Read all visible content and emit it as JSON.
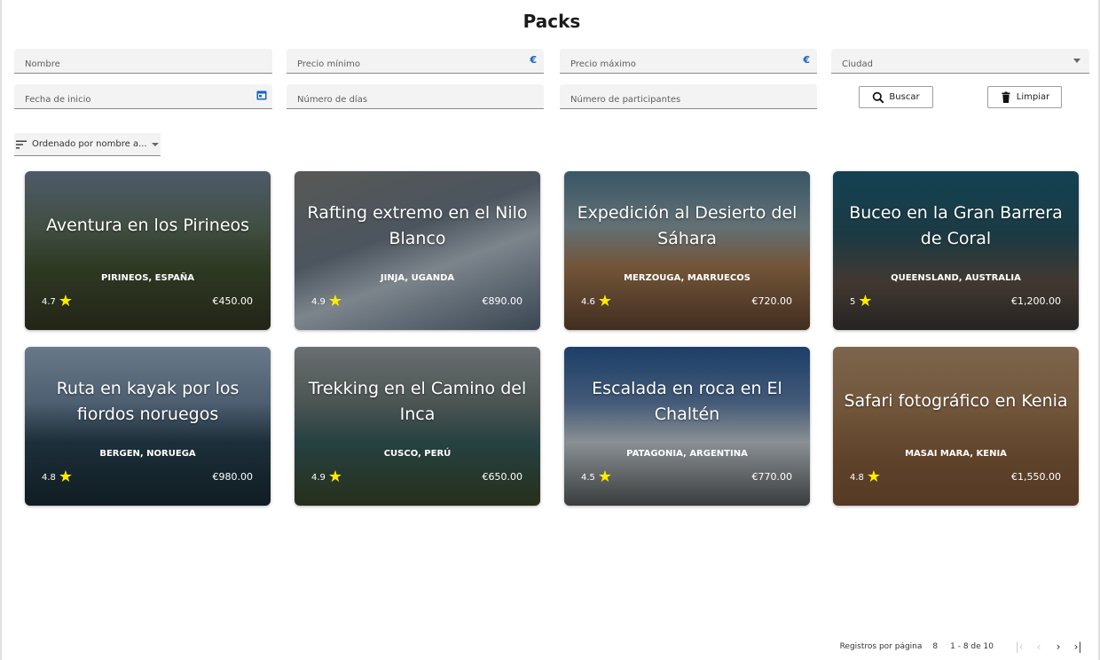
{
  "page": {
    "title": "Packs"
  },
  "filters": {
    "nombre": {
      "placeholder": "Nombre"
    },
    "precio_minimo": {
      "placeholder": "Precio mínimo",
      "suffix": "€"
    },
    "precio_maximo": {
      "placeholder": "Precio máximo",
      "suffix": "€"
    },
    "ciudad": {
      "placeholder": "Ciudad"
    },
    "fecha_inicio": {
      "placeholder": "Fecha de inicio"
    },
    "numero_dias": {
      "placeholder": "Número de días"
    },
    "numero_participantes": {
      "placeholder": "Número de participantes"
    },
    "buscar_label": "Buscar",
    "limpiar_label": "Limpiar"
  },
  "sort": {
    "label": "Ordenado por nombre a..."
  },
  "cards": [
    {
      "title": "Aventura en los Pirineos",
      "location": "PIRINEOS, ESPAÑA",
      "rating": "4.7",
      "price": "€450.00"
    },
    {
      "title": "Rafting extremo en el Nilo Blanco",
      "location": "JINJA, UGANDA",
      "rating": "4.9",
      "price": "€890.00"
    },
    {
      "title": "Expedición al Desierto del Sáhara",
      "location": "MERZOUGA, MARRUECOS",
      "rating": "4.6",
      "price": "€720.00"
    },
    {
      "title": "Buceo en la Gran Barrera de Coral",
      "location": "QUEENSLAND, AUSTRALIA",
      "rating": "5",
      "price": "€1,200.00"
    },
    {
      "title": "Ruta en kayak por los fiordos noruegos",
      "location": "BERGEN, NORUEGA",
      "rating": "4.8",
      "price": "€980.00"
    },
    {
      "title": "Trekking en el Camino del Inca",
      "location": "CUSCO, PERÚ",
      "rating": "4.9",
      "price": "€650.00"
    },
    {
      "title": "Escalada en roca en El Chaltén",
      "location": "PATAGONIA, ARGENTINA",
      "rating": "4.5",
      "price": "€770.00"
    },
    {
      "title": "Safari fotográfico en Kenia",
      "location": "MASAI MARA, KENIA",
      "rating": "4.8",
      "price": "€1,550.00"
    }
  ],
  "paginator": {
    "label": "Registros por página",
    "page_size": "8",
    "range": "1 - 8 de 10",
    "first_icon": "first-page-icon",
    "prev_icon": "chevron-left-icon",
    "next_icon": "chevron-right-icon",
    "last_icon": "last-page-icon"
  },
  "colors": {
    "accent": "#1565c0",
    "star": "#ffeb00"
  }
}
